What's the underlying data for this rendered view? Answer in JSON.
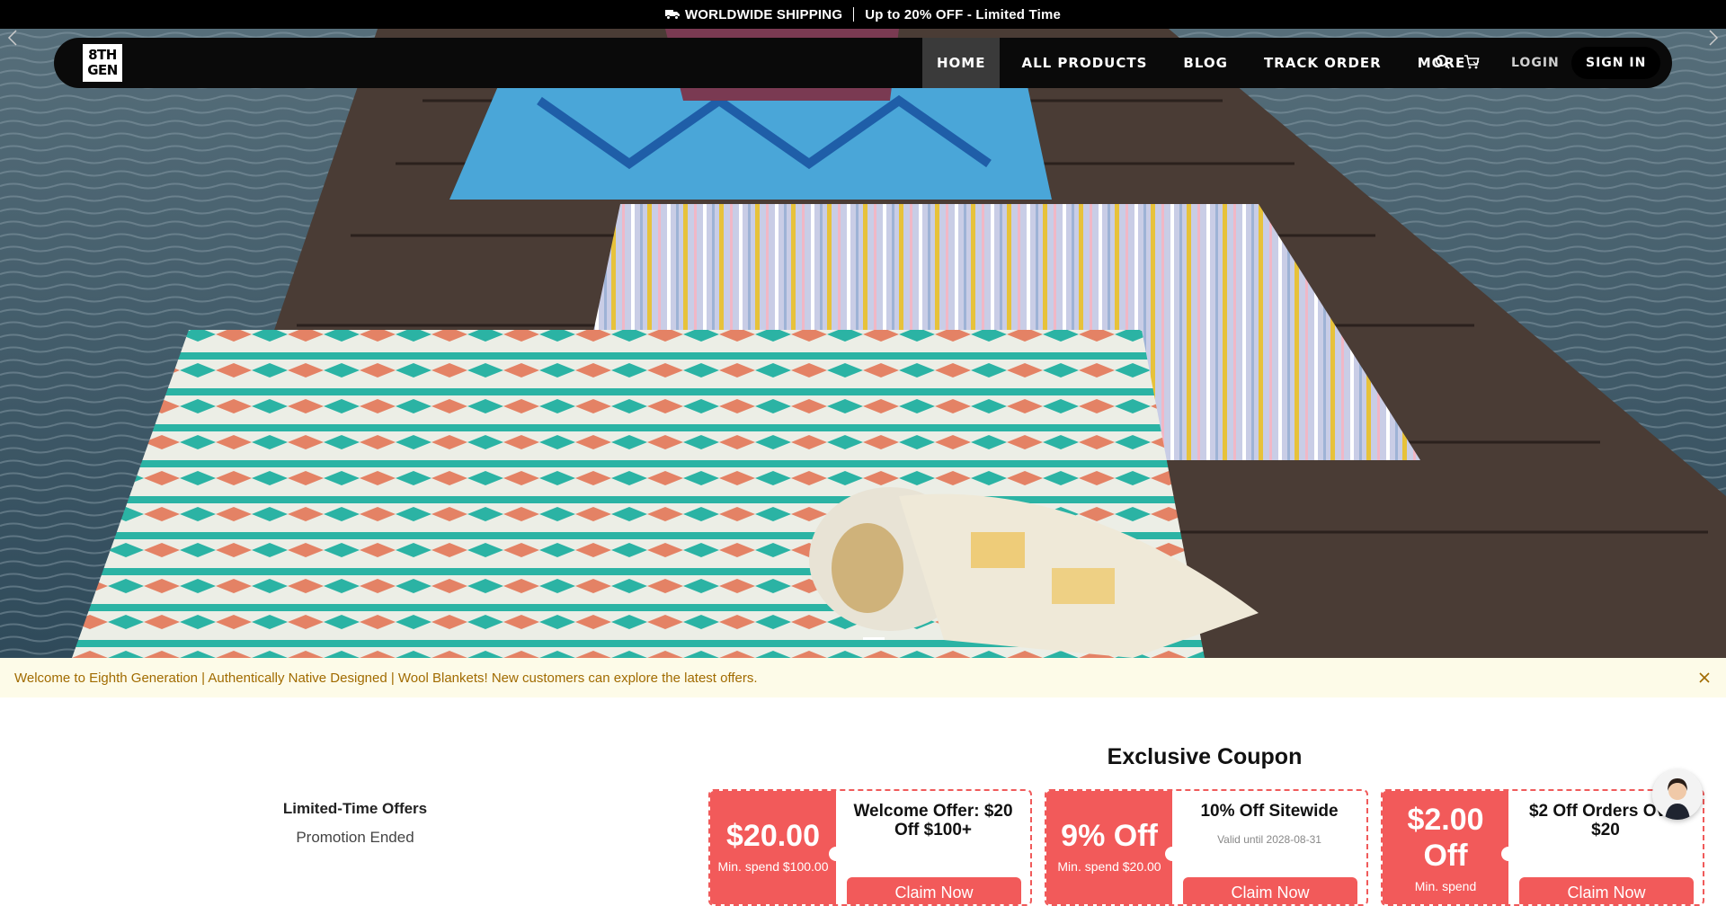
{
  "announcement": {
    "shipping": "WORLDWIDE SHIPPING",
    "offer": "Up to 20% OFF - Limited Time"
  },
  "header": {
    "logo_lines": [
      "8TH",
      "GEN"
    ],
    "nav": [
      {
        "label": "HOME",
        "active": true
      },
      {
        "label": "ALL PRODUCTS",
        "active": false
      },
      {
        "label": "BLOG",
        "active": false
      },
      {
        "label": "TRACK ORDER",
        "active": false
      },
      {
        "label": "MORE",
        "active": false
      }
    ],
    "login_label": "LOGIN",
    "signin_label": "SIGN IN",
    "icons": [
      "search-icon",
      "cart-icon"
    ]
  },
  "hero": {
    "slide_count_indicator": 1
  },
  "welcome_bar": {
    "text": "Welcome to Eighth Generation | Authentically Native Designed | Wool Blankets! New customers can explore the latest offers."
  },
  "offers": {
    "title": "Limited-Time Offers",
    "status": "Promotion Ended"
  },
  "coupons": {
    "heading": "Exclusive Coupon",
    "items": [
      {
        "amount": "$20.00",
        "min": "Min. spend $100.00",
        "title": "Welcome Offer: $20 Off $100+",
        "valid": "",
        "claim": "Claim Now"
      },
      {
        "amount": "9% Off",
        "min": "Min. spend $20.00",
        "title": "10% Off Sitewide",
        "valid": "Valid until 2028-08-31",
        "claim": "Claim Now"
      },
      {
        "amount": "$2.00 Off",
        "min": "Min. spend",
        "title": "$2 Off Orders Over $20",
        "valid": "",
        "claim": "Claim Now"
      }
    ]
  },
  "colors": {
    "coupon_red": "#f25a5a",
    "welcome_bg": "#fdfbe8",
    "welcome_text": "#a16b00"
  }
}
